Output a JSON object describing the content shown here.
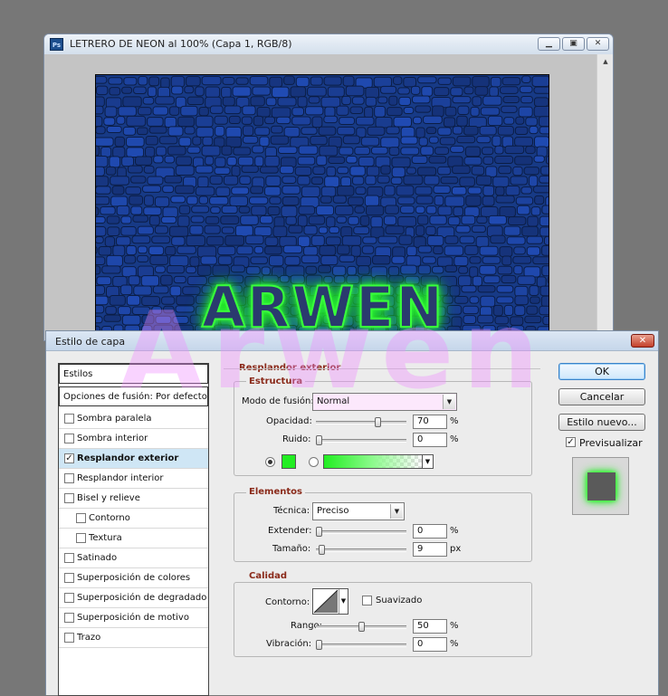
{
  "document": {
    "title": "LETRERO DE NEON  al 100% (Capa 1, RGB/8)",
    "app_icon_label": "Ps",
    "canvas_text": "ARWEN",
    "canvas_color": "#173a86",
    "glow_color": "#3cff3a"
  },
  "watermark": "Arwen",
  "dialog": {
    "title": "Estilo de capa",
    "styles_list": {
      "header": "Estilos",
      "blending_options": "Opciones de fusión: Por defecto",
      "items": [
        {
          "label": "Sombra paralela",
          "checked": false,
          "indent": false,
          "selected": false
        },
        {
          "label": "Sombra interior",
          "checked": false,
          "indent": false,
          "selected": false
        },
        {
          "label": "Resplandor exterior",
          "checked": true,
          "indent": false,
          "selected": true
        },
        {
          "label": "Resplandor interior",
          "checked": false,
          "indent": false,
          "selected": false
        },
        {
          "label": "Bisel y relieve",
          "checked": false,
          "indent": false,
          "selected": false
        },
        {
          "label": "Contorno",
          "checked": false,
          "indent": true,
          "selected": false
        },
        {
          "label": "Textura",
          "checked": false,
          "indent": true,
          "selected": false
        },
        {
          "label": "Satinado",
          "checked": false,
          "indent": false,
          "selected": false
        },
        {
          "label": "Superposición de colores",
          "checked": false,
          "indent": false,
          "selected": false
        },
        {
          "label": "Superposición de degradado",
          "checked": false,
          "indent": false,
          "selected": false
        },
        {
          "label": "Superposición de motivo",
          "checked": false,
          "indent": false,
          "selected": false
        },
        {
          "label": "Trazo",
          "checked": false,
          "indent": false,
          "selected": false
        }
      ]
    },
    "panel_title": "Resplandor exterior",
    "estructura": {
      "title": "Estructura",
      "blend_mode_label": "Modo de fusión:",
      "blend_mode_value": "Normal",
      "opacity_label": "Opacidad:",
      "opacity_value": "70",
      "opacity_pct": 70,
      "noise_label": "Ruido:",
      "noise_value": "0",
      "noise_pct": 0,
      "unit_pct": "%",
      "color_swatch": "#22ee22",
      "solid_color_selected": true
    },
    "elementos": {
      "title": "Elementos",
      "technique_label": "Técnica:",
      "technique_value": "Preciso",
      "spread_label": "Extender:",
      "spread_value": "0",
      "spread_pct": 0,
      "size_label": "Tamaño:",
      "size_value": "9",
      "size_frac": 0.036,
      "unit_pct": "%",
      "unit_px": "px"
    },
    "calidad": {
      "title": "Calidad",
      "contour_label": "Contorno:",
      "antialias_label": "Suavizado",
      "antialias_checked": false,
      "range_label": "Rango:",
      "range_value": "50",
      "range_pct": 50,
      "jitter_label": "Vibración:",
      "jitter_value": "0",
      "jitter_pct": 0,
      "unit_pct": "%"
    },
    "buttons": {
      "ok": "OK",
      "cancel": "Cancelar",
      "new_style": "Estilo nuevo...",
      "preview_label": "Previsualizar",
      "preview_checked": true
    }
  }
}
